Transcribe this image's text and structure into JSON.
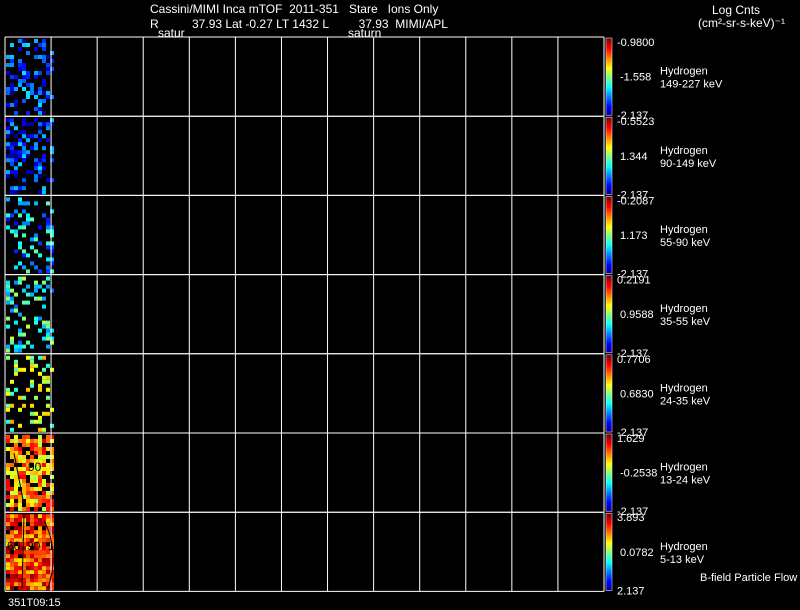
{
  "header": {
    "title": "Cassini/MIMI Inca mTOF  2011-351   Stare   Ions Only",
    "subtitle": "R          37.93 Lat -0.27 LT 1432 L         37.93  MIMI/APL",
    "label_left": "satur",
    "label_right": "saturn",
    "units_line1": "Log Cnts",
    "units_line2": "(cm²-sr-s-keV)⁻¹"
  },
  "footer": {
    "time_label": "351T09:15",
    "note": "B-field Particle Flow"
  },
  "chart_data": {
    "type": "heatmap",
    "grid_columns": 13,
    "panels": [
      {
        "species": "Hydrogen",
        "energy": "149-227 keV",
        "cmax": "-0.9800",
        "cmid": "-1.558",
        "cmin": "-2.137"
      },
      {
        "species": "Hydrogen",
        "energy": "90-149 keV",
        "cmax": "-0.5523",
        "cmid": "1.344",
        "cmin": "-2.137"
      },
      {
        "species": "Hydrogen",
        "energy": "55-90 keV",
        "cmax": "-0.2087",
        "cmid": "1.173",
        "cmin": "-2.137"
      },
      {
        "species": "Hydrogen",
        "energy": "35-55 keV",
        "cmax": "0.2191",
        "cmid": "0.9588",
        "cmin": "-2.137"
      },
      {
        "species": "Hydrogen",
        "energy": "24-35 keV",
        "cmax": "0.7706",
        "cmid": "0.6830",
        "cmin": "-2.137"
      },
      {
        "species": "Hydrogen",
        "energy": "13-24 keV",
        "cmax": "1.629",
        "cmid": "-0.2538",
        "cmin": "-2.137"
      },
      {
        "species": "Hydrogen",
        "energy": "5-13 keV",
        "cmax": "3.893",
        "cmid": "0.0782",
        "cmin": "2.137"
      }
    ],
    "annotations": {
      "panel6": [
        "90"
      ],
      "panel7": [
        "60",
        "90",
        "120"
      ]
    }
  }
}
